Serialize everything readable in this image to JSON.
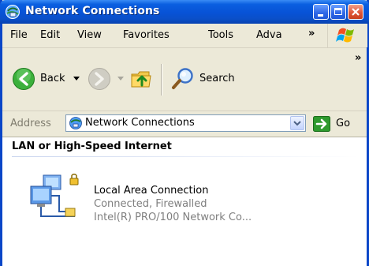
{
  "window": {
    "title": "Network Connections"
  },
  "menubar": {
    "items": [
      {
        "label": "File"
      },
      {
        "label": "Edit"
      },
      {
        "label": "View"
      },
      {
        "label": "Favorites"
      },
      {
        "label": "Tools"
      },
      {
        "label": "Adva"
      }
    ]
  },
  "toolbar": {
    "back_label": "Back",
    "search_label": "Search"
  },
  "address": {
    "label": "Address",
    "value": "Network Connections",
    "go_label": "Go"
  },
  "content": {
    "group_header": "LAN or High-Speed Internet",
    "item": {
      "name": "Local Area Connection",
      "status": "Connected, Firewalled",
      "device": "Intel(R) PRO/100 Network Co..."
    }
  },
  "colors": {
    "titlebar": "#0752d6",
    "window_face": "#ece9d8",
    "back_arrow": "#3bb03b",
    "go_arrow": "#2e9a2e"
  }
}
